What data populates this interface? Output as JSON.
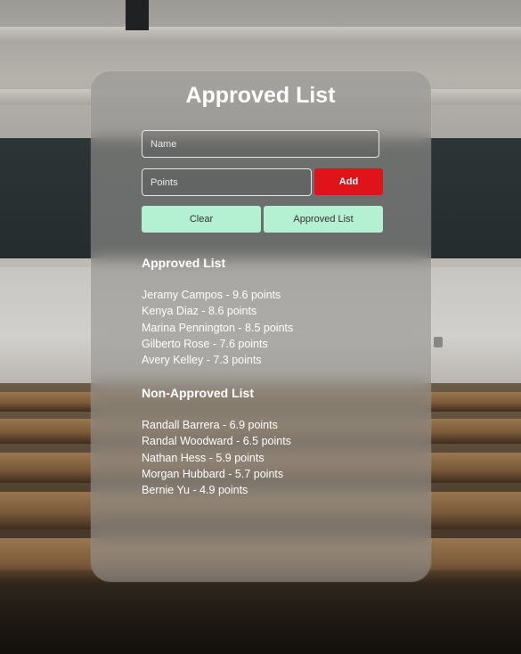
{
  "card": {
    "title": "Approved List"
  },
  "form": {
    "name_placeholder": "Name",
    "points_placeholder": "Points",
    "add_label": "Add",
    "clear_label": "Clear",
    "approved_list_label": "Approved List"
  },
  "approved": {
    "heading": "Approved List",
    "items": [
      "Jeramy Campos - 9.6 points",
      "Kenya Diaz - 8.6 points",
      "Marina Pennington - 8.5 points",
      "Gilberto Rose - 7.6 points",
      "Avery Kelley - 7.3 points"
    ]
  },
  "non_approved": {
    "heading": "Non-Approved List",
    "items": [
      "Randall Barrera - 6.9 points",
      "Randal Woodward - 6.5 points",
      "Nathan Hess - 5.9 points",
      "Morgan Hubbard - 5.7 points",
      "Bernie Yu - 4.9 points"
    ]
  },
  "colors": {
    "add_button": "#e0131a",
    "secondary_button": "#b4f0d2",
    "card_background": "#969492"
  }
}
